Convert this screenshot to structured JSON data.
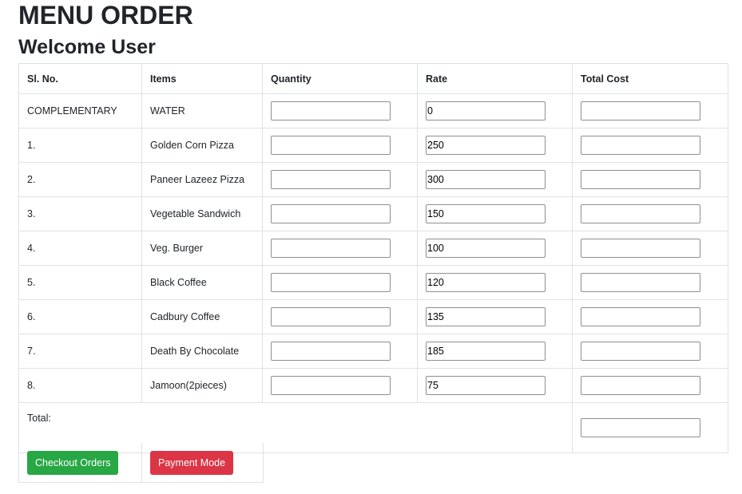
{
  "page": {
    "title": "MENU ORDER",
    "welcome": "Welcome User"
  },
  "table": {
    "headers": [
      "Sl. No.",
      "Items",
      "Quantity",
      "Rate",
      "Total Cost"
    ],
    "rows": [
      {
        "sl": "COMPLEMENTARY",
        "item": "WATER",
        "quantity": "",
        "rate": "0",
        "total": ""
      },
      {
        "sl": "1.",
        "item": "Golden Corn Pizza",
        "quantity": "",
        "rate": "250",
        "total": ""
      },
      {
        "sl": "2.",
        "item": "Paneer Lazeez Pizza",
        "quantity": "",
        "rate": "300",
        "total": ""
      },
      {
        "sl": "3.",
        "item": "Vegetable Sandwich",
        "quantity": "",
        "rate": "150",
        "total": ""
      },
      {
        "sl": "4.",
        "item": "Veg. Burger",
        "quantity": "",
        "rate": "100",
        "total": ""
      },
      {
        "sl": "5.",
        "item": "Black Coffee",
        "quantity": "",
        "rate": "120",
        "total": ""
      },
      {
        "sl": "6.",
        "item": "Cadbury Coffee",
        "quantity": "",
        "rate": "135",
        "total": ""
      },
      {
        "sl": "7.",
        "item": "Death By Chocolate",
        "quantity": "",
        "rate": "185",
        "total": ""
      },
      {
        "sl": "8.",
        "item": "Jamoon(2pieces)",
        "quantity": "",
        "rate": "75",
        "total": ""
      }
    ],
    "total_label": "Total:",
    "total_value": ""
  },
  "actions": {
    "checkout_label": "Checkout Orders",
    "payment_label": "Payment Mode"
  },
  "colors": {
    "checkout_button": "#28a745",
    "payment_button": "#dc3545",
    "border": "#dee2e6"
  }
}
